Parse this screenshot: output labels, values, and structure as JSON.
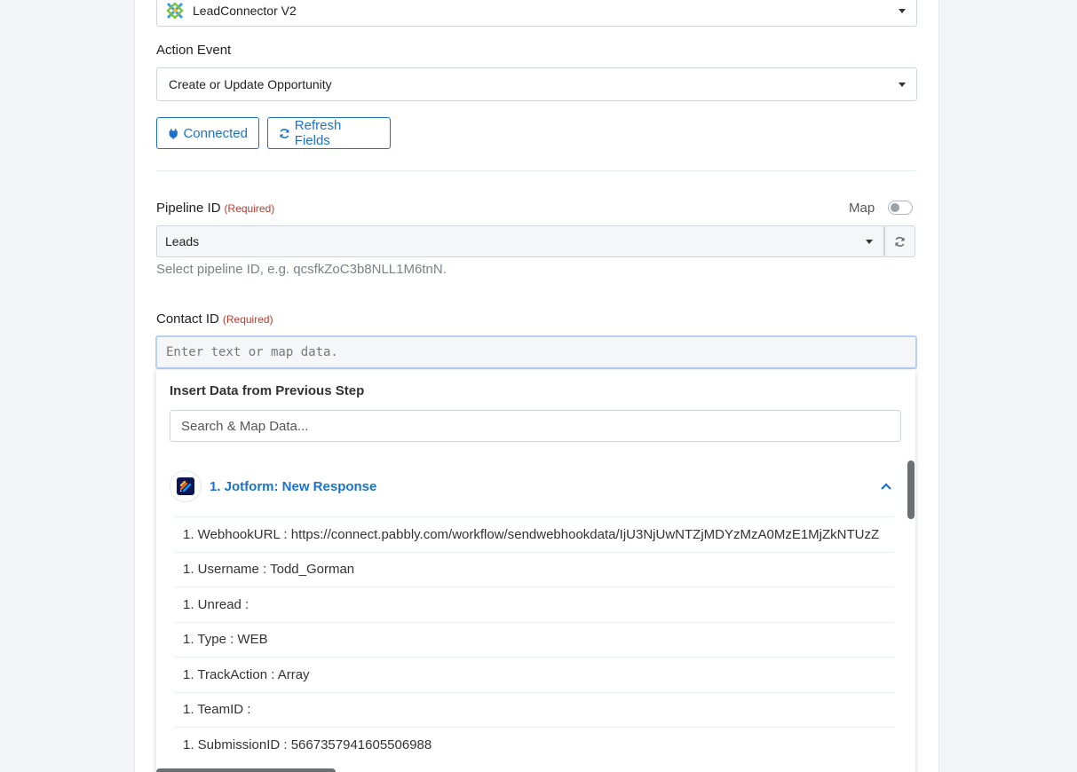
{
  "app_select": {
    "value": "LeadConnector V2",
    "icon": "leadconnector-logo-icon"
  },
  "action_event": {
    "label": "Action Event",
    "value": "Create or Update Opportunity"
  },
  "buttons": {
    "connected": "Connected",
    "refresh": "Refresh Fields"
  },
  "pipeline": {
    "label": "Pipeline ID",
    "required": "(Required)",
    "map_label": "Map",
    "value": "Leads",
    "help": "Select pipeline ID, e.g. qcsfkZoC3b8NLL1M6tnN."
  },
  "contact": {
    "label": "Contact ID",
    "required": "(Required)",
    "placeholder": "Enter text or map data."
  },
  "dropdown": {
    "title": "Insert Data from Previous Step",
    "search_placeholder": "Search & Map Data...",
    "step_title": "1. Jotform: New Response",
    "rows": [
      "1. WebhookURL : https://connect.pabbly.com/workflow/sendwebhookdata/IjU3NjUwNTZjMDYzMzA0MzE1MjZkNTUzZ",
      "1. Username : Todd_Gorman",
      "1. Unread :",
      "1. Type : WEB",
      "1. TrackAction : Array",
      "1. TeamID :",
      "1. SubmissionID : 5667357941605506988"
    ]
  },
  "colors": {
    "accent": "#1a73c8",
    "required": "#c0392b"
  }
}
